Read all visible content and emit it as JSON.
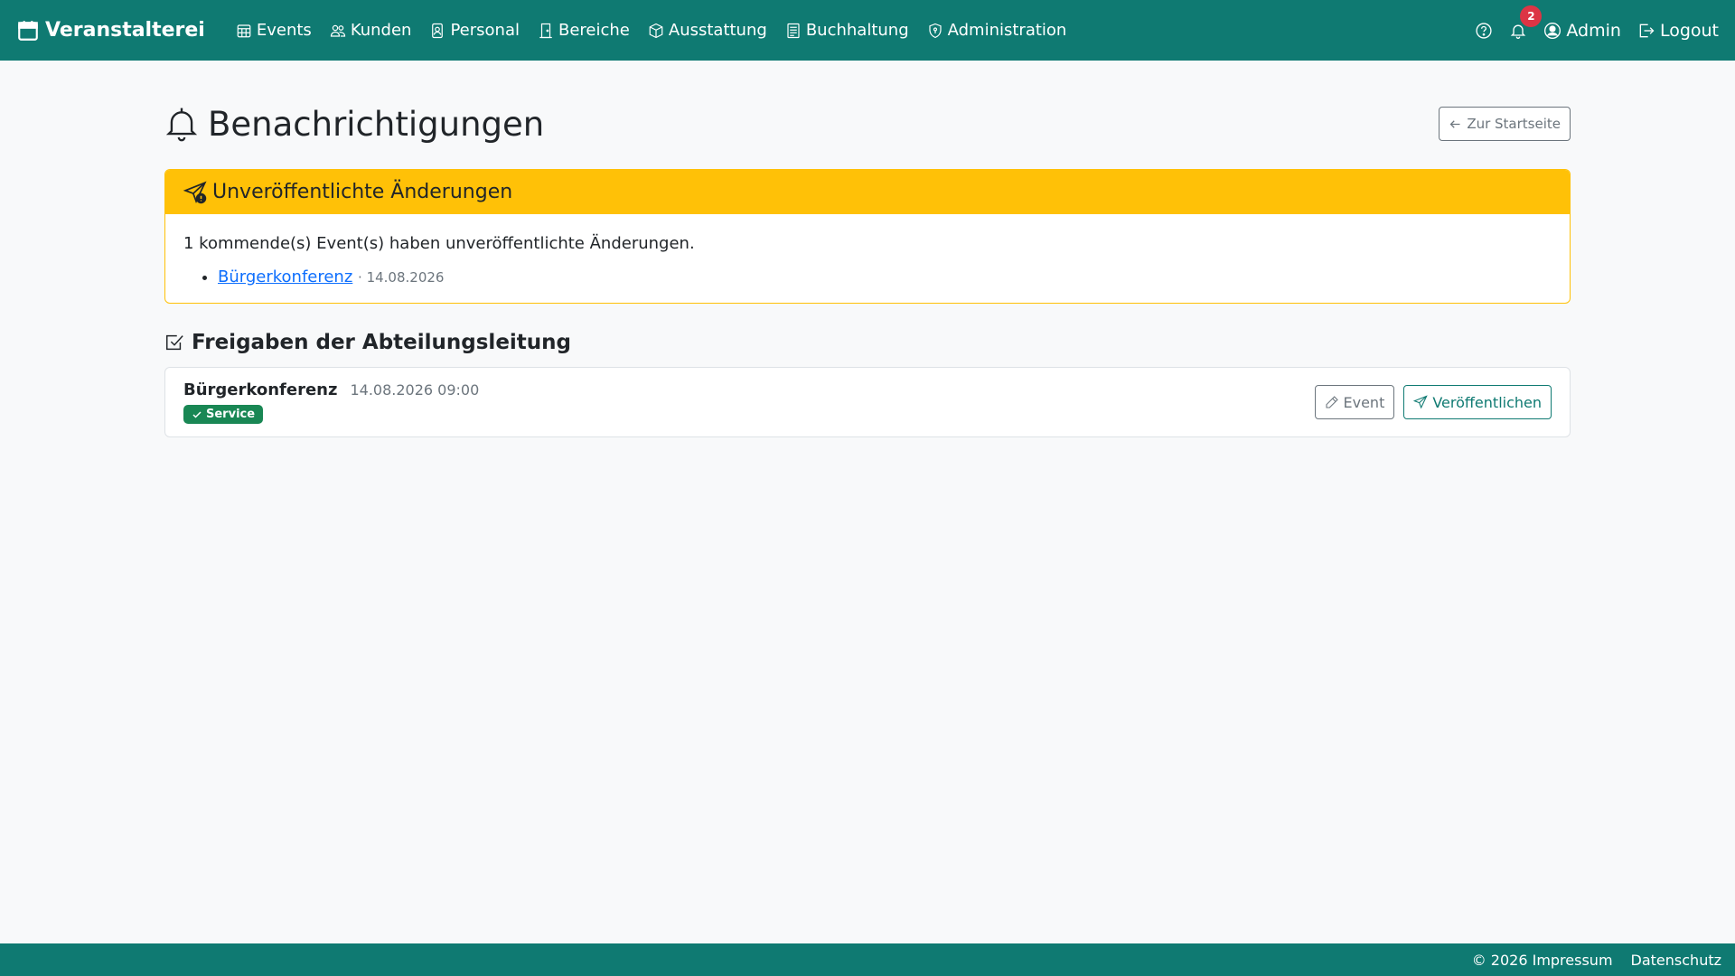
{
  "navbar": {
    "brand": "Veranstalterei",
    "items": [
      {
        "label": "Events",
        "icon": "calendar-grid-icon"
      },
      {
        "label": "Kunden",
        "icon": "people-icon"
      },
      {
        "label": "Personal",
        "icon": "person-badge-icon"
      },
      {
        "label": "Bereiche",
        "icon": "door-icon"
      },
      {
        "label": "Ausstattung",
        "icon": "box-icon"
      },
      {
        "label": "Buchhaltung",
        "icon": "ledger-icon"
      },
      {
        "label": "Administration",
        "icon": "shield-icon"
      }
    ],
    "notification_count": "2",
    "user_label": "Admin",
    "logout_label": "Logout"
  },
  "page": {
    "title": "Benachrichtigungen",
    "back_button": "Zur Startseite"
  },
  "unpublished": {
    "header": "Unveröffentlichte Änderungen",
    "message": "1 kommende(s) Event(s) haben unveröffentlichte Änderungen.",
    "events": [
      {
        "name": "Bürgerkonferenz",
        "date": "· 14.08.2026"
      }
    ]
  },
  "approvals": {
    "title": "Freigaben der Abteilungsleitung",
    "items": [
      {
        "name": "Bürgerkonferenz",
        "datetime": "14.08.2026 09:00",
        "badge": "Service",
        "edit_label": "Event",
        "publish_label": "Veröffentlichen"
      }
    ]
  },
  "footer": {
    "copyright": "© 2026 Impressum",
    "privacy": "Datenschutz"
  },
  "colors": {
    "brand": "#0f7a72",
    "warning": "#ffc107",
    "success": "#198754",
    "danger": "#dc3545",
    "link": "#0d6efd"
  }
}
